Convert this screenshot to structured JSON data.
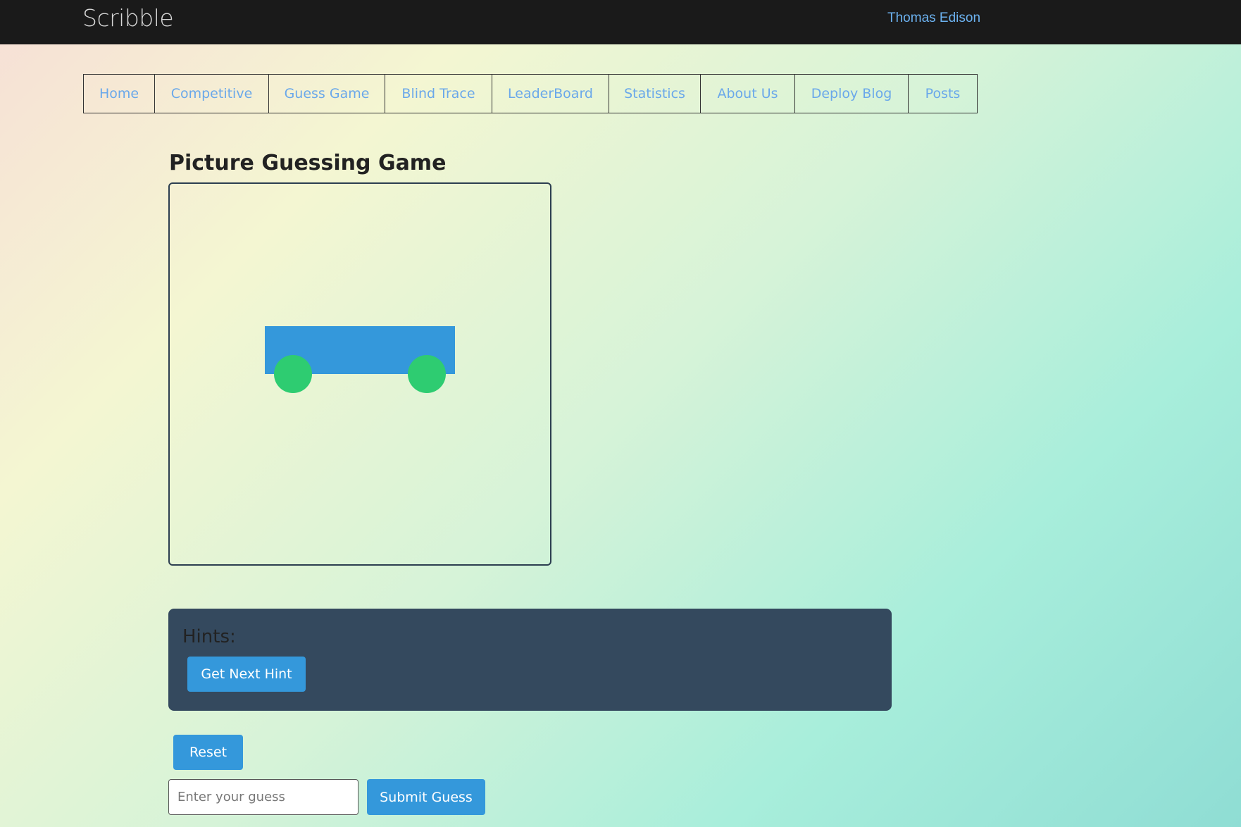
{
  "header": {
    "brand": "Scribble",
    "user": "Thomas Edison"
  },
  "nav": {
    "items": [
      {
        "label": "Home"
      },
      {
        "label": "Competitive"
      },
      {
        "label": "Guess Game"
      },
      {
        "label": "Blind Trace"
      },
      {
        "label": "LeaderBoard"
      },
      {
        "label": "Statistics"
      },
      {
        "label": "About Us"
      },
      {
        "label": "Deploy Blog"
      },
      {
        "label": "Posts"
      }
    ]
  },
  "main": {
    "title": "Picture Guessing Game",
    "drawing": {
      "body_color": "#3498db",
      "wheel_color": "#2ecc71"
    }
  },
  "hints": {
    "title": "Hints:",
    "next_hint_label": "Get Next Hint"
  },
  "controls": {
    "reset_label": "Reset",
    "guess_placeholder": "Enter your guess",
    "submit_label": "Submit Guess"
  },
  "colors": {
    "topbar": "#1a1a1a",
    "link": "#6aa8ea",
    "button": "#3498db",
    "panel": "#34495e"
  }
}
